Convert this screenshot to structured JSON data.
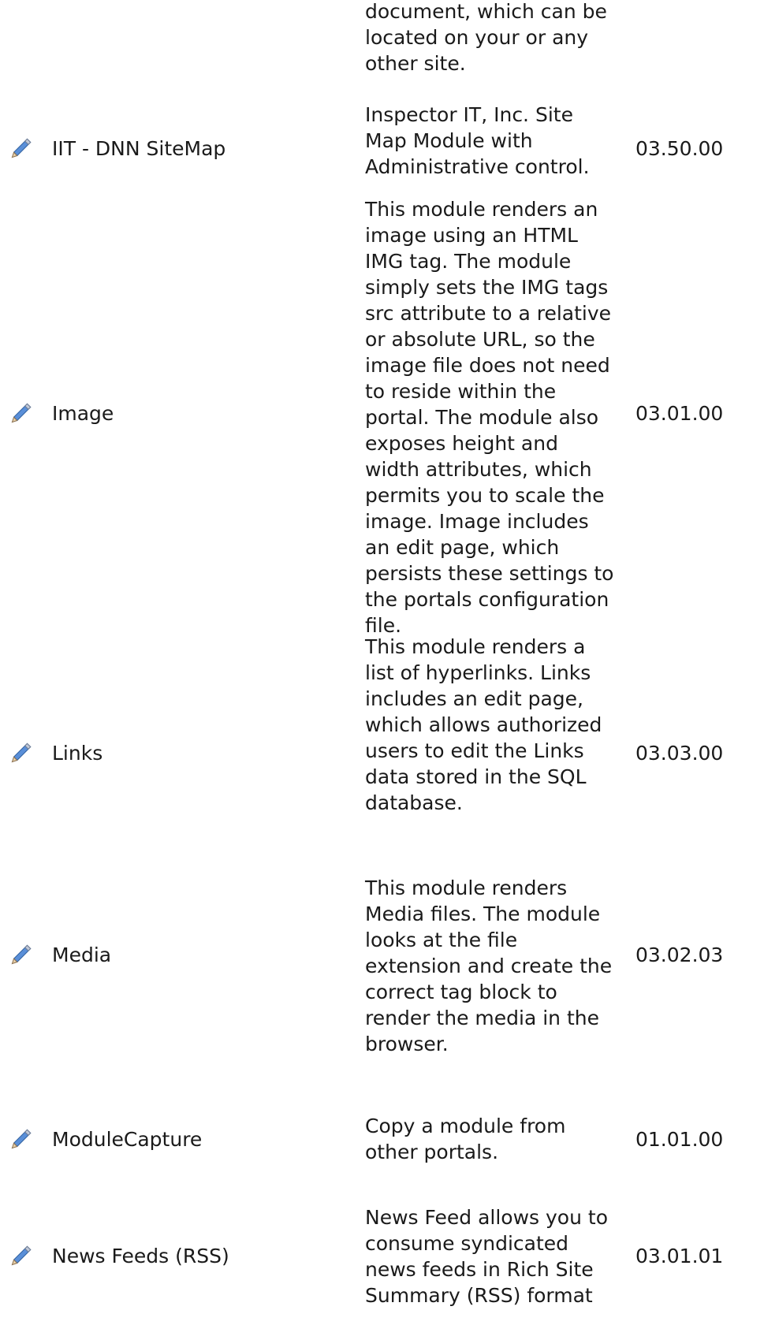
{
  "modules": [
    {
      "name": "",
      "description": "document, which can be located on your or any other site.",
      "version": ""
    },
    {
      "name": "IIT - DNN SiteMap",
      "description": "Inspector IT, Inc. Site Map Module with Administrative control.",
      "version": "03.50.00"
    },
    {
      "name": "Image",
      "description": "This module renders an image using an HTML IMG tag. The module simply sets the IMG tags src attribute to a relative or absolute URL, so the image file does not need to reside within the portal. The module also exposes height and width attributes, which permits you to scale the image. Image includes an edit page, which persists these settings to the portals configuration file.",
      "version": "03.01.00"
    },
    {
      "name": "Links",
      "description": "This module renders a list of hyperlinks. Links includes an edit page, which allows authorized users to edit the Links data stored in the SQL database.",
      "version": "03.03.00"
    },
    {
      "name": "Media",
      "description": "This module renders Media files. The module looks at the file extension and create the correct tag block to render the media in the browser.",
      "version": "03.02.03"
    },
    {
      "name": "ModuleCapture",
      "description": "Copy a module from other portals.",
      "version": "01.01.00"
    },
    {
      "name": "News Feeds (RSS)",
      "description": "News Feed allows you to consume syndicated news feeds in Rich Site Summary (RSS) format",
      "version": "03.01.01"
    }
  ],
  "icons": {
    "edit": "pencil-icon"
  }
}
